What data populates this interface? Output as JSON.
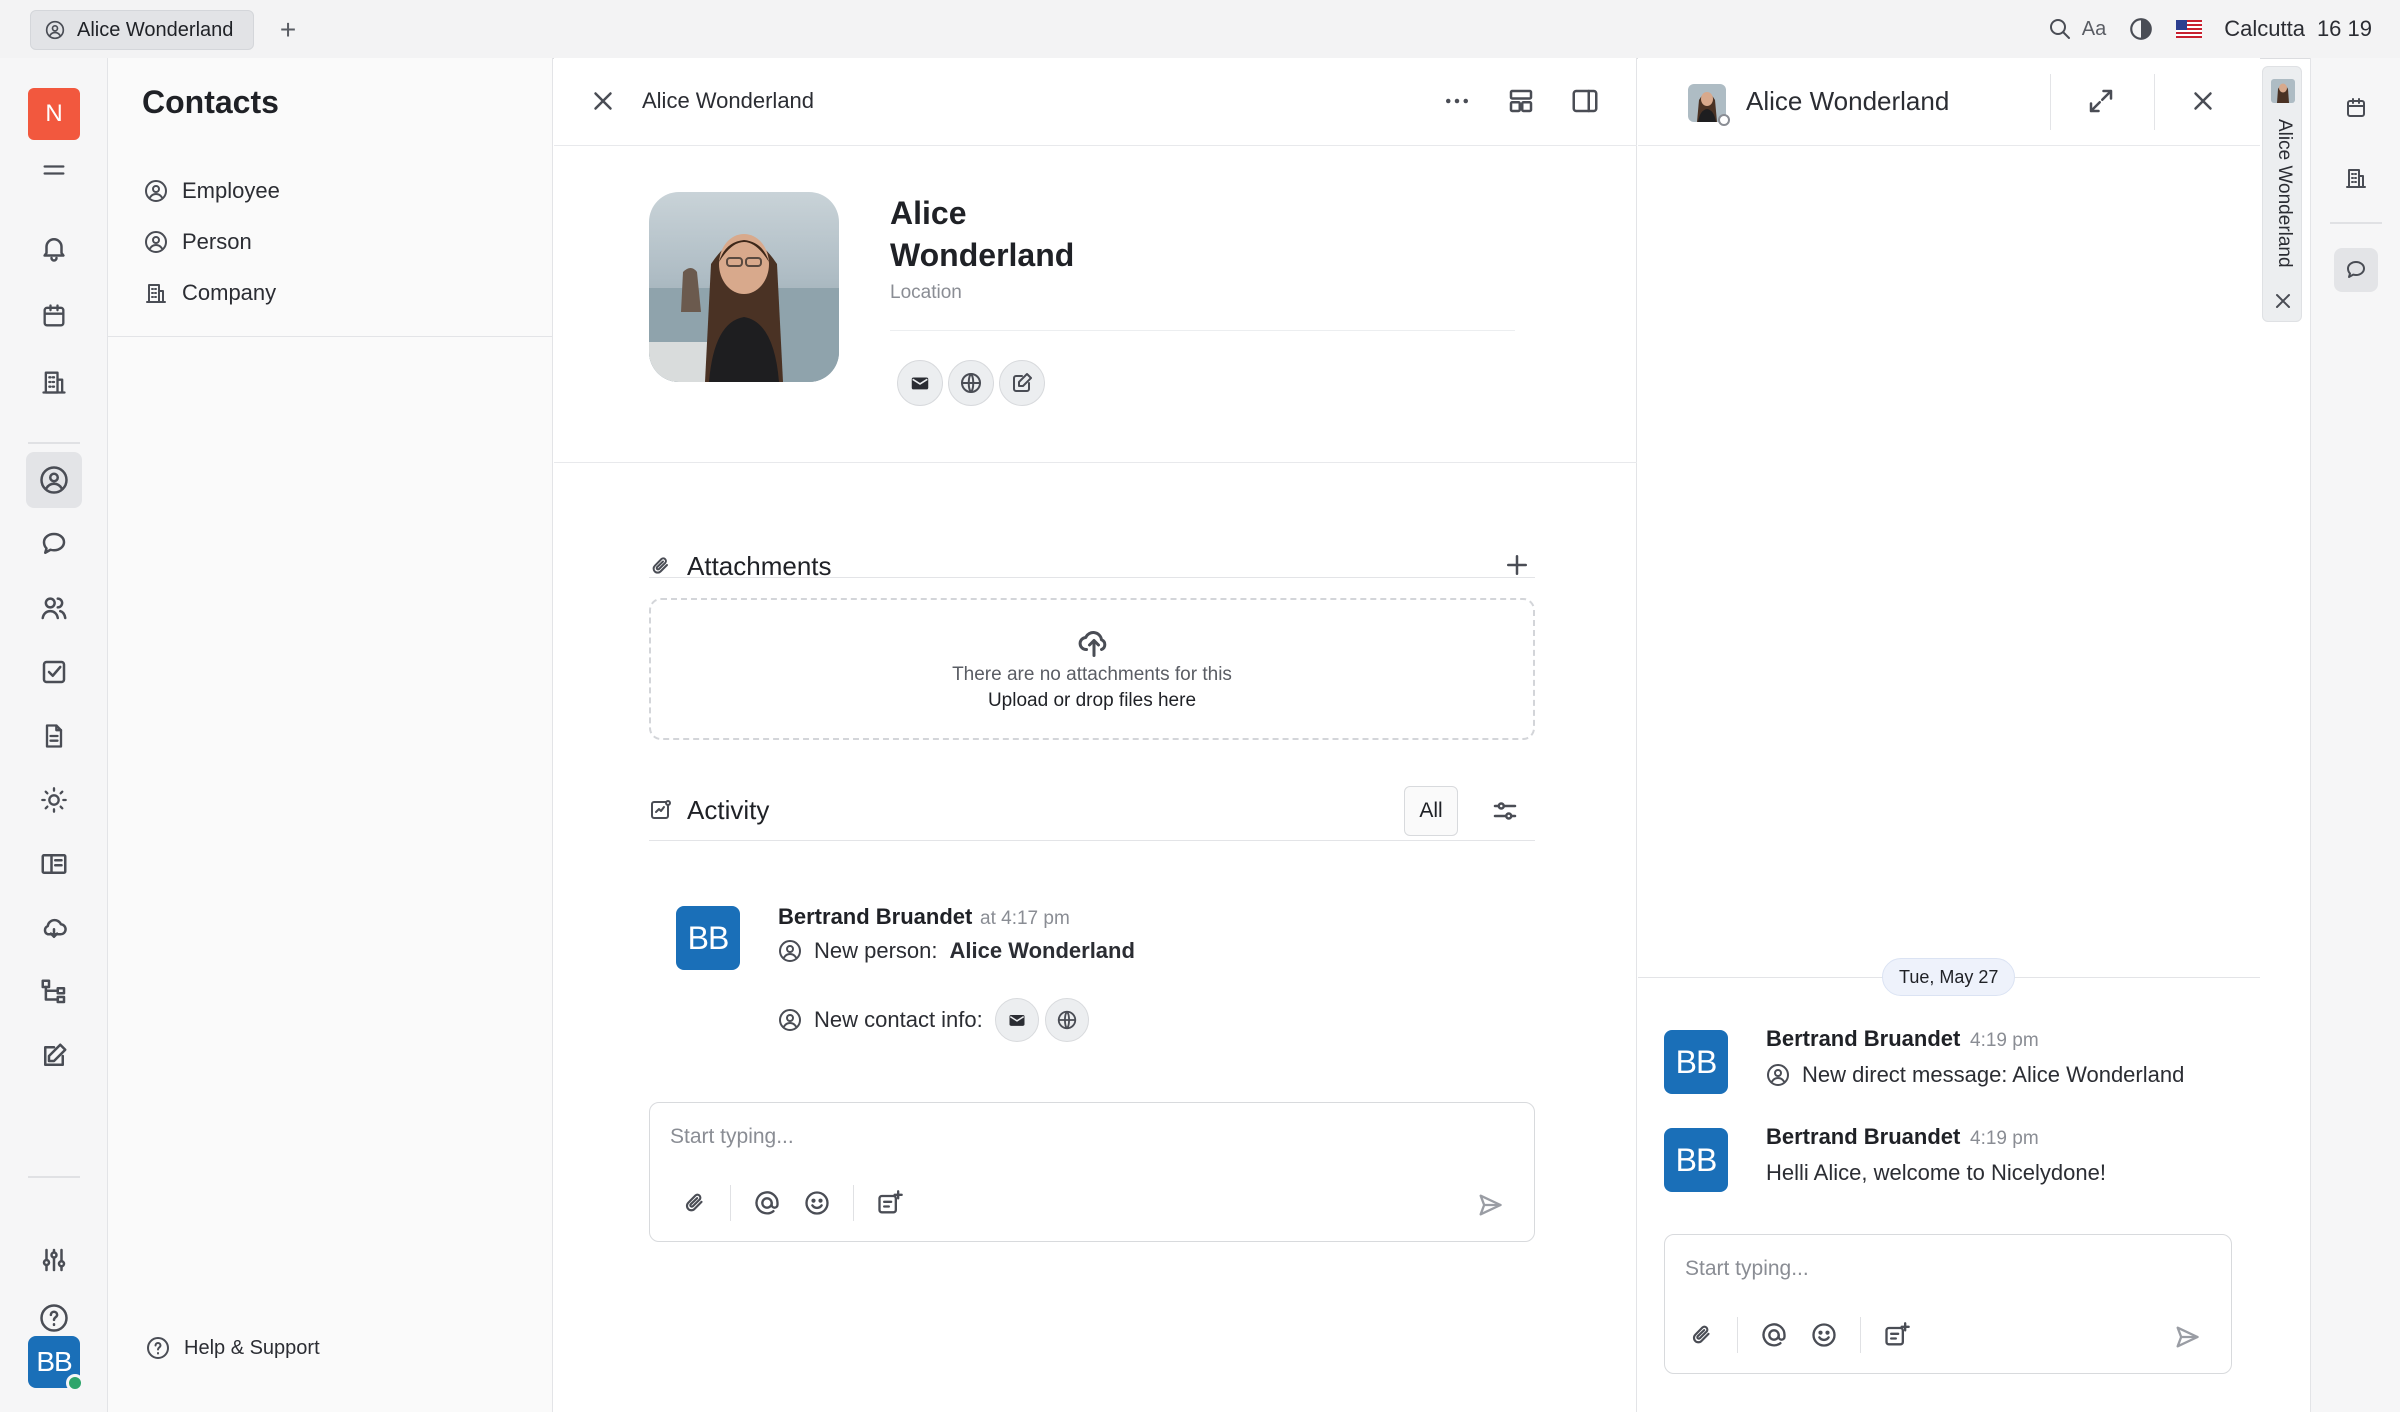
{
  "topbar": {
    "tab_label": "Alice Wonderland",
    "add_tab_symbol": "+",
    "font_label": "Aa",
    "location_label": "Calcutta",
    "time": "16 19"
  },
  "rail": {
    "logo_letter": "N",
    "user_initials": "BB"
  },
  "nav": {
    "title": "Contacts",
    "items": [
      {
        "label": "Employee",
        "icon": "person-circle-icon"
      },
      {
        "label": "Person",
        "icon": "person-circle-icon"
      },
      {
        "label": "Company",
        "icon": "building-icon"
      }
    ],
    "help_label": "Help & Support"
  },
  "detail": {
    "header_title": "Alice Wonderland",
    "first_name": "Alice",
    "last_name": "Wonderland",
    "location_placeholder": "Location",
    "attachments": {
      "title": "Attachments",
      "empty_text": "There are no attachments for this",
      "upload_text": "Upload or drop files here"
    },
    "activity": {
      "title": "Activity",
      "filter_label": "All",
      "items": [
        {
          "initials": "BB",
          "author": "Bertrand Bruandet",
          "time": "at 4:17 pm",
          "line1_prefix": "New person:",
          "line1_value": "Alice Wonderland",
          "line2_prefix": "New contact info:"
        }
      ]
    },
    "composer_placeholder": "Start typing..."
  },
  "chat": {
    "title": "Alice Wonderland",
    "date_separator": "Tue, May 27",
    "messages": [
      {
        "initials": "BB",
        "author": "Bertrand Bruandet",
        "time": "4:19 pm",
        "text": "New direct message: Alice Wonderland"
      },
      {
        "initials": "BB",
        "author": "Bertrand Bruandet",
        "time": "4:19 pm",
        "text": "Helli Alice, welcome to Nicelydone!"
      }
    ],
    "composer_placeholder": "Start typing..."
  },
  "vertical_tab": {
    "label": "Alice Wonderland"
  },
  "colors": {
    "brand_orange": "#f2583e",
    "avatar_blue": "#1a6fb8",
    "online_green": "#2ea56b"
  }
}
